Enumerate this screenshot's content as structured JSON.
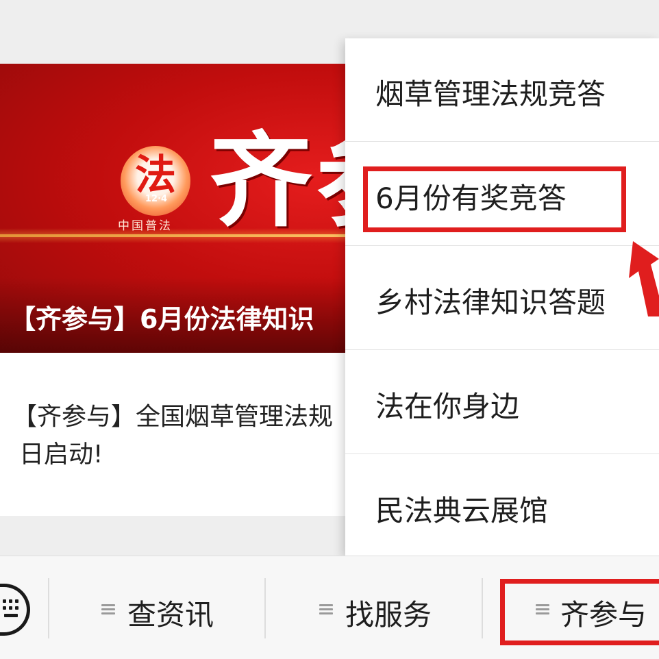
{
  "banner": {
    "logo_char": "法",
    "logo_number": "12·4",
    "logo_caption": "中国普法",
    "big_text": "齐参",
    "caption": "【齐参与】6月份法律知识"
  },
  "article": {
    "title_line1": "【齐参与】全国烟草管理法规",
    "title_line2": "日启动!"
  },
  "dropdown": {
    "items": [
      {
        "label": "烟草管理法规竞答"
      },
      {
        "label": "6月份有奖竞答"
      },
      {
        "label": "乡村法律知识答题"
      },
      {
        "label": "法在你身边"
      },
      {
        "label": "民法典云展馆"
      }
    ],
    "highlighted_index": 1
  },
  "bottom_nav": {
    "keyboard_icon": "keyboard-icon",
    "tabs": [
      {
        "label": "查资讯",
        "icon": "menu-icon"
      },
      {
        "label": "找服务",
        "icon": "menu-icon"
      },
      {
        "label": "齐参与",
        "icon": "menu-icon",
        "highlighted": true
      }
    ]
  },
  "colors": {
    "annotation_red": "#e01e1e",
    "banner_red": "#c10d0d"
  }
}
